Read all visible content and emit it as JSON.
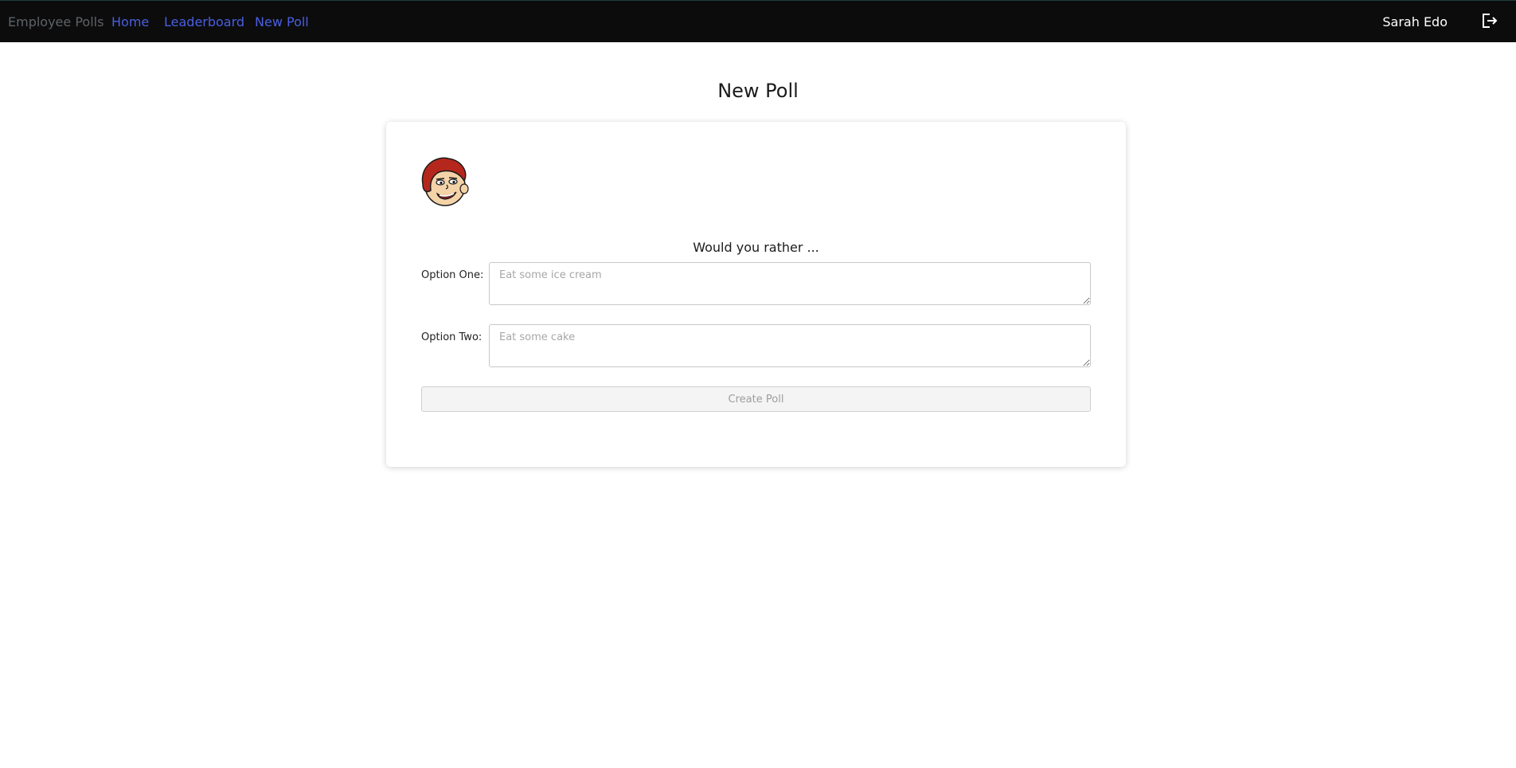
{
  "nav": {
    "brand": "Employee Polls",
    "links": [
      {
        "label": "Home"
      },
      {
        "label": "Leaderboard"
      },
      {
        "label": "New Poll"
      }
    ],
    "user_name": "Sarah Edo",
    "logout_icon": "logout-icon"
  },
  "page": {
    "title": "New Poll"
  },
  "form": {
    "avatar_icon": "avatar",
    "question": "Would you rather ...",
    "option_one": {
      "label": "Option One:",
      "value": "",
      "placeholder": "Eat some ice cream"
    },
    "option_two": {
      "label": "Option Two:",
      "value": "",
      "placeholder": "Eat some cake"
    },
    "submit_label": "Create Poll",
    "submit_disabled": true
  },
  "colors": {
    "nav_bg": "#0c0c0d",
    "link": "#4a5fe0",
    "brand": "#5f6367",
    "avatar_hair": "#b5271c",
    "avatar_skin": "#f4d3a8"
  }
}
